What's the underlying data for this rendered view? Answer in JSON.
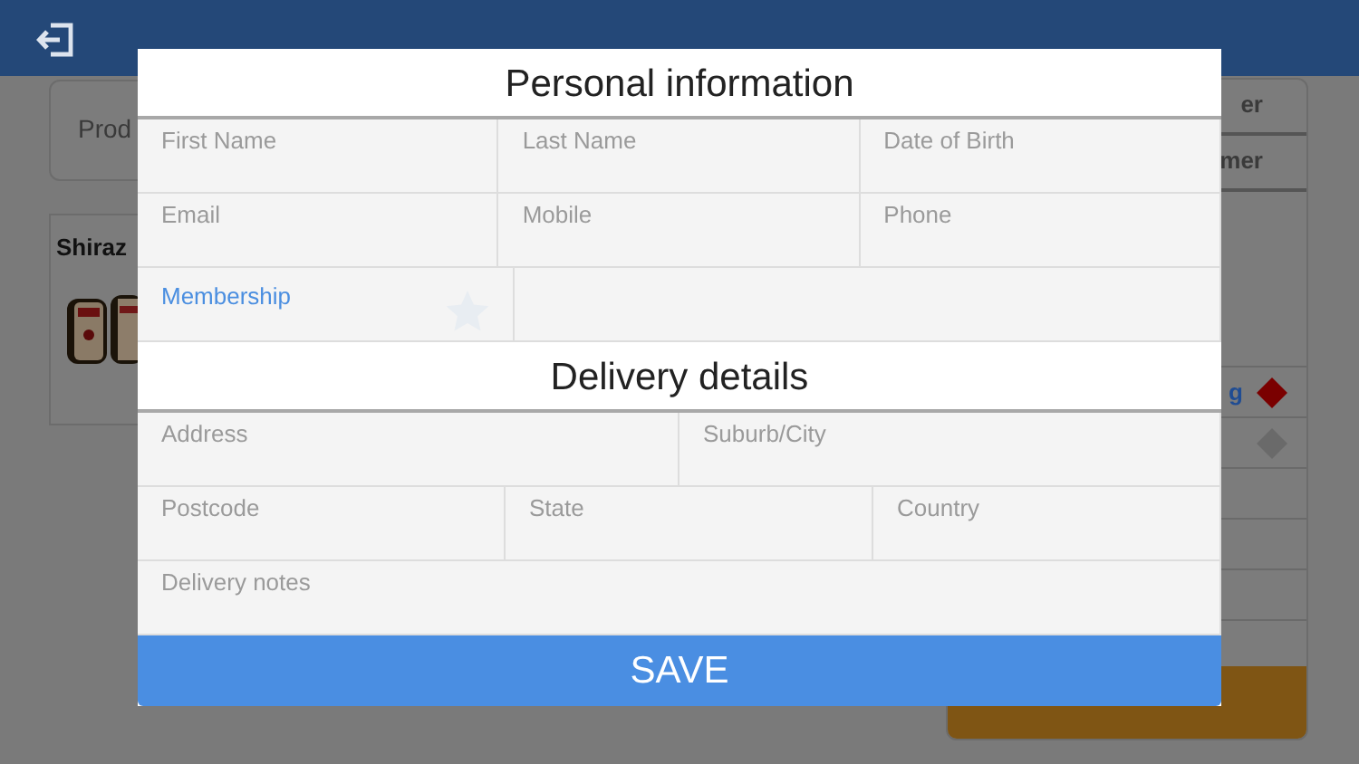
{
  "background": {
    "search_field": {
      "placeholder": "Prod"
    },
    "product_card": {
      "title": "Shiraz"
    },
    "side_panel": {
      "tabs": [
        {
          "label": "er"
        },
        {
          "label": "mer"
        }
      ],
      "items": [
        {
          "label": "g",
          "color": "#7a0000"
        },
        {
          "color": "#6a6a6a"
        }
      ]
    }
  },
  "dialog": {
    "sections": [
      {
        "title": "Personal information",
        "rows": [
          [
            {
              "kind": "input",
              "placeholder": "First Name"
            },
            {
              "kind": "input",
              "placeholder": "Last Name"
            },
            {
              "kind": "input",
              "placeholder": "Date of Birth"
            }
          ],
          [
            {
              "kind": "input",
              "placeholder": "Email"
            },
            {
              "kind": "input",
              "placeholder": "Mobile"
            },
            {
              "kind": "input",
              "placeholder": "Phone"
            }
          ],
          [
            {
              "kind": "membership",
              "label": "Membership",
              "starred": false
            },
            {
              "kind": "blank"
            }
          ]
        ]
      },
      {
        "title": "Delivery details",
        "rows": [
          [
            {
              "kind": "input",
              "placeholder": "Address"
            },
            {
              "kind": "input",
              "placeholder": "Suburb/City"
            }
          ],
          [
            {
              "kind": "group",
              "fields": [
                {
                  "kind": "input",
                  "placeholder": "Postcode"
                },
                {
                  "kind": "input",
                  "placeholder": "State"
                }
              ]
            },
            {
              "kind": "input",
              "placeholder": "Country"
            }
          ],
          [
            {
              "kind": "input",
              "placeholder": "Delivery notes"
            }
          ]
        ]
      }
    ],
    "save_button": "SAVE"
  }
}
